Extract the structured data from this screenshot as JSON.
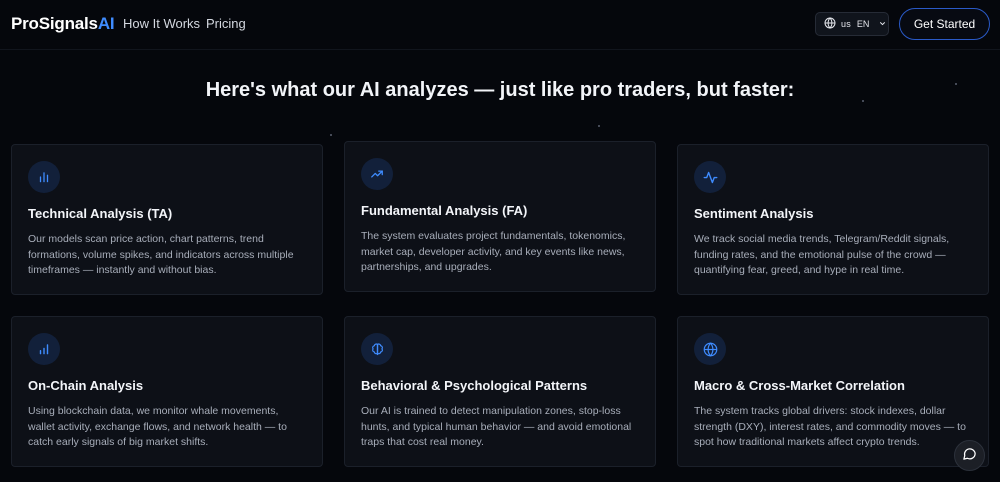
{
  "header": {
    "logo_main": "ProSignals",
    "logo_accent": "AI",
    "nav": [
      "How It Works",
      "Pricing"
    ],
    "lang_code": "us",
    "lang_label": "EN",
    "cta_label": "Get Started"
  },
  "headline": "Here's what our AI analyzes — just like pro traders, but faster:",
  "cards": [
    {
      "icon": "bar-chart-icon",
      "title": "Technical Analysis (TA)",
      "desc": "Our models scan price action, chart patterns, trend formations, volume spikes, and indicators across multiple timeframes — instantly and without bias."
    },
    {
      "icon": "trending-up-icon",
      "title": "Fundamental Analysis (FA)",
      "desc": "The system evaluates project fundamentals, tokenomics, market cap, developer activity, and key events like news, partnerships, and upgrades."
    },
    {
      "icon": "pulse-icon",
      "title": "Sentiment Analysis",
      "desc": "We track social media trends, Telegram/Reddit signals, funding rates, and the emotional pulse of the crowd — quantifying fear, greed, and hype in real time."
    },
    {
      "icon": "signal-bars-icon",
      "title": "On-Chain Analysis",
      "desc": "Using blockchain data, we monitor whale movements, wallet activity, exchange flows, and network health — to catch early signals of big market shifts."
    },
    {
      "icon": "brain-icon",
      "title": "Behavioral & Psychological Patterns",
      "desc": "Our AI is trained to detect manipulation zones, stop-loss hunts, and typical human behavior — and avoid emotional traps that cost real money."
    },
    {
      "icon": "globe-icon",
      "title": "Macro & Cross-Market Correlation",
      "desc": "The system tracks global drivers: stock indexes, dollar strength (DXY), interest rates, and commodity moves — to spot how traditional markets affect crypto trends."
    }
  ],
  "colors": {
    "accent": "#3f8cff",
    "background": "#05070c",
    "card": "#0d1017",
    "icon_bg": "#12203a"
  }
}
